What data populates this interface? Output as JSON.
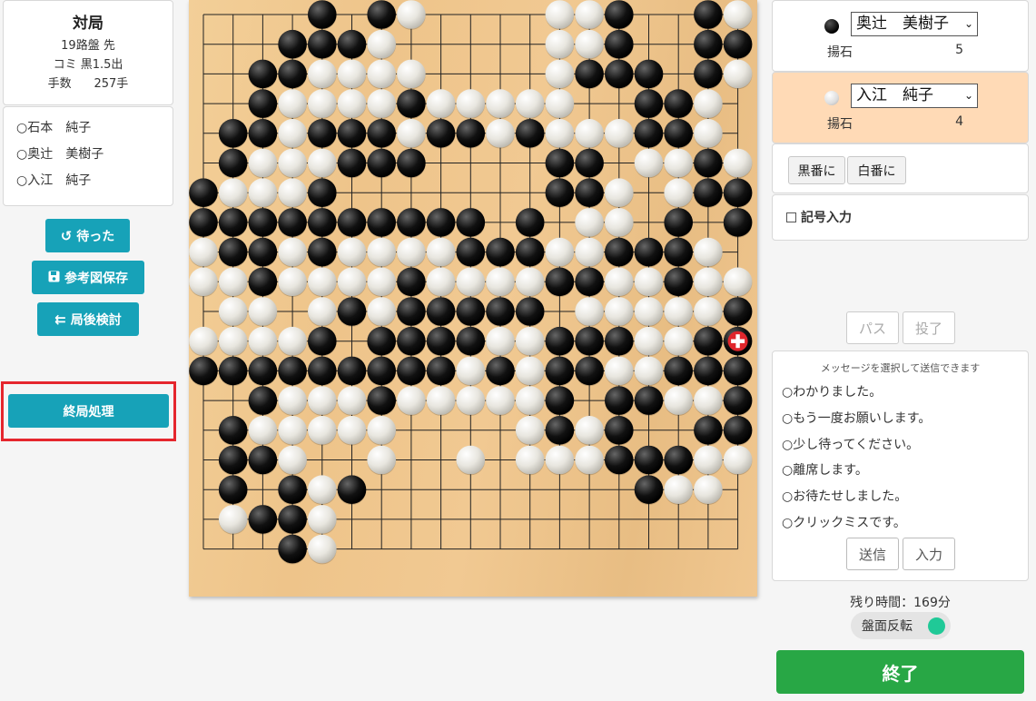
{
  "game_info": {
    "title": "対局",
    "board": "19路盤 先",
    "komi": "コミ 黒1.5出",
    "moves_label": "手数",
    "moves_value": "257手"
  },
  "players_list": [
    "○石本　純子",
    "○奥辻　美樹子",
    "○入江　純子"
  ],
  "left_buttons": {
    "undo": "待った",
    "save": "参考図保存",
    "review": "局後検討",
    "end_processing": "終局処理"
  },
  "black_player": {
    "name": "奥辻　美樹子",
    "captures_label": "揚石",
    "captures": "5"
  },
  "white_player": {
    "name": "入江　純子",
    "captures_label": "揚石",
    "captures": "4",
    "active_bg": "#ffdab6"
  },
  "turn_buttons": {
    "black": "黒番に",
    "white": "白番に"
  },
  "notation_input": "記号入力",
  "action_buttons": {
    "pass": "パス",
    "resign": "投了"
  },
  "messages": {
    "header": "メッセージを選択して送信できます",
    "items": [
      "○わかりました。",
      "○もう一度お願いします。",
      "○少し待ってください。",
      "○離席します。",
      "○お待たせしました。",
      "○クリックミスです。"
    ],
    "send": "送信",
    "input": "入力"
  },
  "remaining_time": "残り時間：169分",
  "flip_board": "盤面反転",
  "finish_button": "終了",
  "board": {
    "size": 19,
    "last_move_marker": "red-cross",
    "rows": [
      "....B.BW....WWB..BW",
      "...BBBW.....WWB..BBW",
      "..BBWWWW....WBBB.BW.",
      "..BWWWWBWWWWW..BBW..",
      ".BBWBBBWBBWBWWWBBW.",
      ".BWWWBBB....BB.WWBW",
      "BWWWB.......BBW.WBB",
      "BBBBBBBBBB.B.WW.B.B",
      "WBBWBWWWWBBBWWBBBW",
      "WWBWWWWBWWWWBBWWBWWW",
      ".WW.WBWBBBBB.WWWWWB",
      "WWWWB.BBBBWWBBBWWBX",
      "BBBBBBBBBWBWBBWWBBB",
      "..BWWWBWWWWWB.BBWWB",
      ".BWWWWW....WBWB..BBW",
      ".BBW..W..W.WWWBBBWWW",
      ".B.BWB.........BWW.W",
      ".WBBW..............",
      "...BW.............."
    ]
  },
  "colors": {
    "teal": "#17a2b8",
    "green": "#28a745",
    "red_outline": "#e5262d",
    "toggle": "#20c997"
  }
}
